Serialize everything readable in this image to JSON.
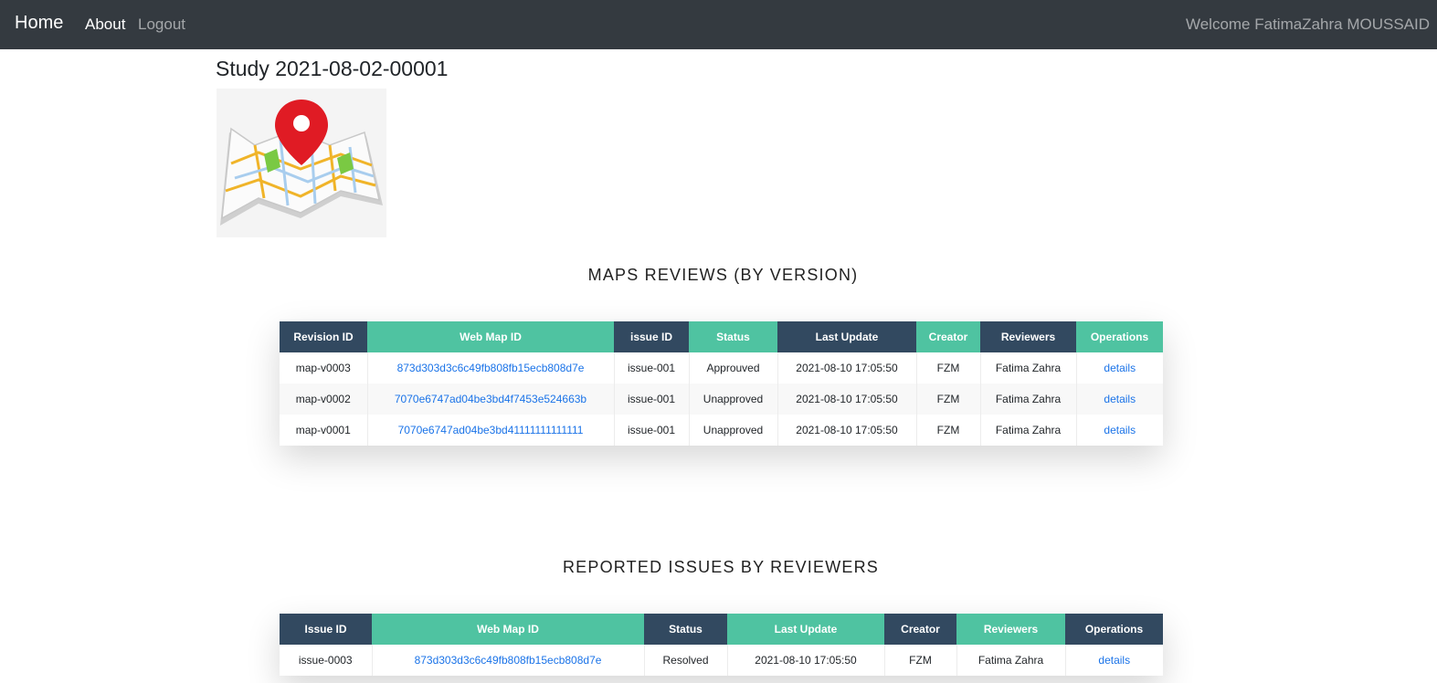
{
  "nav": {
    "brand": "Home",
    "links": [
      "About",
      "Logout"
    ],
    "welcome": "Welcome FatimaZahra MOUSSAID"
  },
  "study": {
    "title": "Study 2021-08-02-00001",
    "image_icon": "map-location-pin-icon"
  },
  "maps_reviews": {
    "title": "MAPS REVIEWS (BY VERSION)",
    "columns": [
      "Revision ID",
      "Web Map ID",
      "issue ID",
      "Status",
      "Last Update",
      "Creator",
      "Reviewers",
      "Operations"
    ],
    "rows": [
      [
        "map-v0003",
        "873d303d3c6c49fb808fb15ecb808d7e",
        "issue-001",
        "Approuved",
        "2021-08-10 17:05:50",
        "FZM",
        "Fatima Zahra",
        "details"
      ],
      [
        "map-v0002",
        "7070e6747ad04be3bd4f7453e524663b",
        "issue-001",
        "Unapproved",
        "2021-08-10 17:05:50",
        "FZM",
        "Fatima Zahra",
        "details"
      ],
      [
        "map-v0001",
        "7070e6747ad04be3bd41111111111111",
        "issue-001",
        "Unapproved",
        "2021-08-10 17:05:50",
        "FZM",
        "Fatima Zahra",
        "details"
      ]
    ]
  },
  "reported_issues": {
    "title": "REPORTED ISSUES BY REVIEWERS",
    "columns": [
      "Issue ID",
      "Web Map ID",
      "Status",
      "Last Update",
      "Creator",
      "Reviewers",
      "Operations"
    ],
    "rows": [
      [
        "issue-0003",
        "873d303d3c6c49fb808fb15ecb808d7e",
        "Resolved",
        "2021-08-10 17:05:50",
        "FZM",
        "Fatima Zahra",
        "details"
      ]
    ]
  },
  "colors": {
    "navbar": "#343a40",
    "header_dark": "#324960",
    "header_green": "#4fc3a1",
    "link": "#1a73e8"
  }
}
